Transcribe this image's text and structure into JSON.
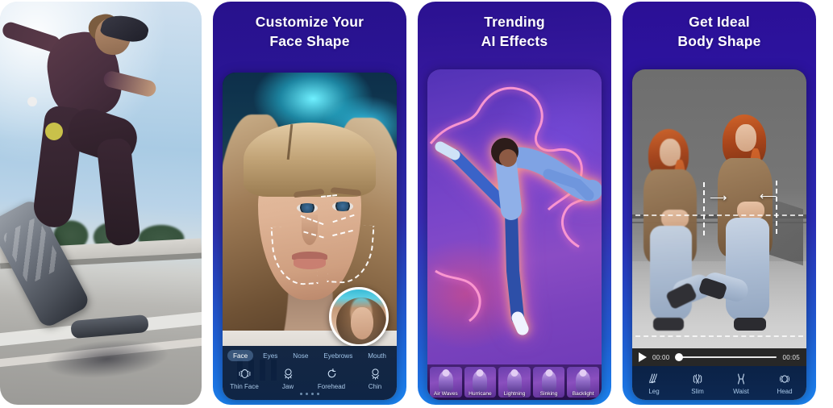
{
  "gallery": {
    "panels": [
      {
        "id": "panel-skateboard",
        "headline_line1": "",
        "headline_line2": "",
        "media_alt": "skateboarder mid-trick against blue sky"
      },
      {
        "id": "panel-face-shape",
        "headline_line1": "Customize Your",
        "headline_line2": "Face Shape",
        "media_alt": "portrait of blonde woman with dashed face-reshape guides",
        "editor": {
          "tabs": [
            {
              "label": "Face",
              "selected": true
            },
            {
              "label": "Eyes",
              "selected": false
            },
            {
              "label": "Nose",
              "selected": false
            },
            {
              "label": "Eyebrows",
              "selected": false
            },
            {
              "label": "Mouth",
              "selected": false
            }
          ],
          "tools": [
            {
              "label": "Thin Face",
              "icon": "thin-face-icon"
            },
            {
              "label": "Jaw",
              "icon": "jaw-icon"
            },
            {
              "label": "Forehead",
              "icon": "forehead-icon"
            },
            {
              "label": "Chin",
              "icon": "chin-icon"
            }
          ],
          "preview_thumbnail": "before-preview-thumbnail"
        }
      },
      {
        "id": "panel-ai-effects",
        "headline_line1": "Trending",
        "headline_line2": "AI Effects",
        "media_alt": "dancer with neon glow outline and lightning effect",
        "effects": [
          {
            "label": "Air Waves",
            "selected": false
          },
          {
            "label": "Hurricane",
            "selected": false
          },
          {
            "label": "Lightning",
            "selected": false
          },
          {
            "label": "Sinking",
            "selected": false
          },
          {
            "label": "Backlight",
            "selected": false
          }
        ]
      },
      {
        "id": "panel-body-shape",
        "headline_line1": "Get Ideal",
        "headline_line2": "Body Shape",
        "media_alt": "before and after body reshaping of woman in tan coat",
        "player": {
          "play_label": "play-button",
          "current_time": "00:00",
          "total_time": "00:05",
          "progress_percent": 0
        },
        "tools": [
          {
            "label": "Leg",
            "icon": "leg-icon"
          },
          {
            "label": "Slim",
            "icon": "slim-icon"
          },
          {
            "label": "Waist",
            "icon": "waist-icon"
          },
          {
            "label": "Head",
            "icon": "head-icon"
          }
        ]
      }
    ]
  },
  "colors": {
    "panel_top": "#2a1290",
    "panel_bottom": "#1b85f2",
    "accent_blue": "#1b85f2",
    "headline_text": "#ffffff",
    "editor_bar": "#0a2042",
    "tab_active_bg": "#78a5d7",
    "effect_glow": "#ff9bd2"
  }
}
